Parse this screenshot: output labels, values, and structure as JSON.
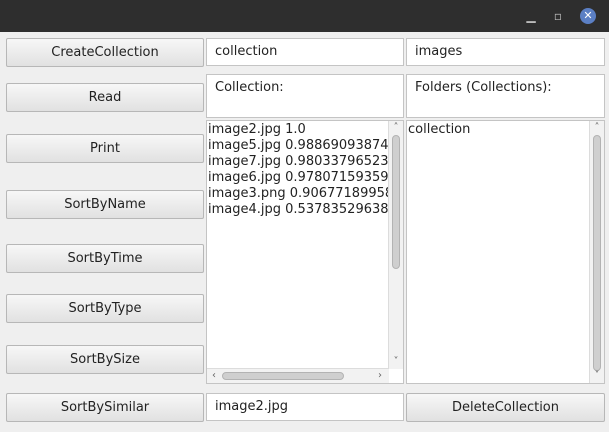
{
  "window": {
    "minimize_glyph": "▁",
    "restore_glyph": "▫",
    "close_glyph": "✕"
  },
  "buttons": {
    "create": "CreateCollection",
    "read": "Read",
    "print": "Print",
    "sort_name": "SortByName",
    "sort_time": "SortByTime",
    "sort_type": "SortByType",
    "sort_size": "SortBySize",
    "sort_similar": "SortBySimilar",
    "delete": "DeleteCollection"
  },
  "fields": {
    "collection_name": "collection",
    "folder_name": "images",
    "similar_image": "image2.jpg"
  },
  "text_areas": {
    "collection_label": "Collection:",
    "folders_label": "Folders (Collections):"
  },
  "image_list": [
    "image2.jpg 1.0",
    "image5.jpg 0.98869093874",
    "image7.jpg 0.98033796523",
    "image6.jpg 0.97807159359",
    "image3.png 0.90677189958",
    "image4.jpg 0.53783529638"
  ],
  "collection_list": [
    "collection"
  ],
  "icons": {
    "up": "˄",
    "down": "˅",
    "left": "‹",
    "right": "›"
  }
}
